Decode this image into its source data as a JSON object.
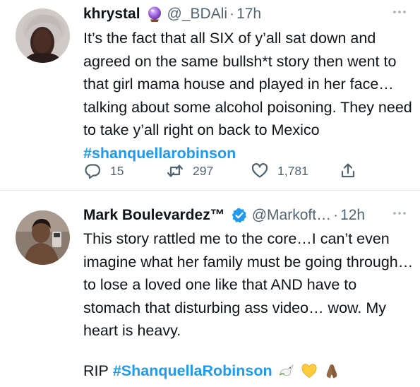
{
  "tweets": [
    {
      "author": "khrystal",
      "badge": "crystal-ball-emoji",
      "handle": "@_BDAli",
      "separator": "·",
      "time": "17h",
      "text": "It’s the fact that all SIX of y’all sat down and agreed on the same bullsh*t story then went to that girl mama house and played in her face… talking about some alcohol poisoning. They need to take y’all right on back to Mexico ",
      "hashtag": "#shanquellarobinson",
      "replies": "15",
      "retweets": "297",
      "likes": "1,781"
    },
    {
      "author": "Mark Boulevardez™",
      "badge": "verified-badge",
      "handle": "@Markoft…",
      "separator": "·",
      "time": "12h",
      "text": "This story rattled me to the core…I can’t even imagine what her family must be going through…to lose a loved one like that AND have to stomach that disturbing ass video… wow. My heart is heavy.",
      "rip_prefix": "RIP",
      "hashtag": "#ShanquellaRobinson",
      "emojis": [
        "dove-emoji",
        "yellow-heart-emoji",
        "folded-hands-emoji"
      ]
    }
  ],
  "colors": {
    "text": "#0f1419",
    "secondary": "#536471",
    "link": "#1d9bf0",
    "divider": "#e3e7ea",
    "verified": "#1d9bf0"
  }
}
